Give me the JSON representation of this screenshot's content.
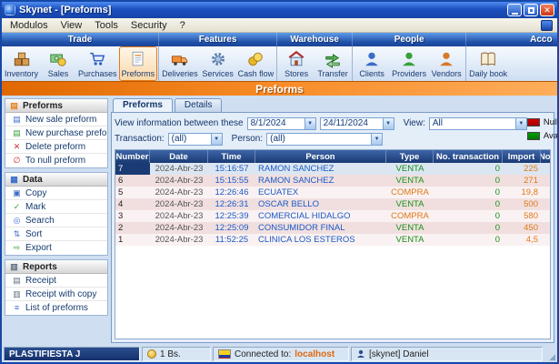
{
  "window": {
    "title": "Skynet - [Preforms]",
    "menu": [
      "Modulos",
      "View",
      "Tools",
      "Security",
      "?"
    ]
  },
  "ribbon": {
    "active_item": "Preforms",
    "groups": [
      {
        "label": "Trade",
        "items": [
          {
            "label": "Inventory",
            "icon": "inventory-icon"
          },
          {
            "label": "Sales",
            "icon": "sales-icon"
          },
          {
            "label": "Purchases",
            "icon": "purchases-icon"
          },
          {
            "label": "Preforms",
            "icon": "preforms-icon"
          }
        ]
      },
      {
        "label": "Features",
        "items": [
          {
            "label": "Deliveries",
            "icon": "deliveries-icon"
          },
          {
            "label": "Services",
            "icon": "services-icon"
          },
          {
            "label": "Cash flow",
            "icon": "cashflow-icon"
          }
        ]
      },
      {
        "label": "Warehouse",
        "items": [
          {
            "label": "Stores",
            "icon": "stores-icon"
          },
          {
            "label": "Transfer",
            "icon": "transfer-icon"
          }
        ]
      },
      {
        "label": "People",
        "items": [
          {
            "label": "Clients",
            "icon": "clients-icon"
          },
          {
            "label": "Providers",
            "icon": "providers-icon"
          },
          {
            "label": "Vendors",
            "icon": "vendors-icon"
          }
        ]
      },
      {
        "label": "Acco",
        "items": [
          {
            "label": "Daily book",
            "icon": "dailybook-icon"
          }
        ]
      }
    ]
  },
  "banner": {
    "title": "Preforms"
  },
  "sidebar": {
    "sections": [
      {
        "title": "Preforms",
        "icon": "preforms-section-icon",
        "items": [
          {
            "label": "New sale preform",
            "icon": "document-blue-icon"
          },
          {
            "label": "New purchase preform",
            "icon": "document-green-icon"
          },
          {
            "label": "Delete preform",
            "icon": "delete-icon"
          },
          {
            "label": "To null preform",
            "icon": "null-icon"
          }
        ]
      },
      {
        "title": "Data",
        "icon": "data-section-icon",
        "items": [
          {
            "label": "Copy",
            "icon": "copy-icon"
          },
          {
            "label": "Mark",
            "icon": "mark-icon"
          },
          {
            "label": "Search",
            "icon": "search-icon"
          },
          {
            "label": "Sort",
            "icon": "sort-icon"
          },
          {
            "label": "Export",
            "icon": "export-icon"
          }
        ]
      },
      {
        "title": "Reports",
        "icon": "reports-section-icon",
        "items": [
          {
            "label": "Receipt",
            "icon": "receipt-icon"
          },
          {
            "label": "Receipt with copy",
            "icon": "receipt-copy-icon"
          },
          {
            "label": "List of preforms",
            "icon": "list-icon"
          }
        ]
      }
    ]
  },
  "main": {
    "tabs": [
      "Preforms",
      "Details"
    ],
    "active_tab": "Preforms",
    "filters": {
      "between_label": "View information between these",
      "date_from": "8/1/2024",
      "date_to": "24/11/2024",
      "view_label": "View:",
      "view_value": "All",
      "transaction_label": "Transaction:",
      "transaction_value": "(all)",
      "person_label": "Person:",
      "person_value": "(all)"
    },
    "legend": [
      {
        "label": "Null transaction",
        "color": "#D80000"
      },
      {
        "label": "Available",
        "color": "#00A000"
      }
    ],
    "table": {
      "columns": [
        "Number",
        "Date",
        "Time",
        "Person",
        "Type",
        "No. transaction",
        "Import",
        "Note"
      ],
      "rows": [
        [
          "7",
          "2024-Abr-23",
          "15:16:57",
          "RAMON SANCHEZ",
          "VENTA",
          "0",
          "225",
          ""
        ],
        [
          "6",
          "2024-Abr-23",
          "15:15:55",
          "RAMON SANCHEZ",
          "VENTA",
          "0",
          "271",
          ""
        ],
        [
          "5",
          "2024-Abr-23",
          "12:26:46",
          "ECUATEX",
          "COMPRA",
          "0",
          "19,8",
          ""
        ],
        [
          "4",
          "2024-Abr-23",
          "12:26:31",
          "OSCAR BELLO",
          "VENTA",
          "0",
          "500",
          ""
        ],
        [
          "3",
          "2024-Abr-23",
          "12:25:39",
          "COMERCIAL HIDALGO",
          "COMPRA",
          "0",
          "580",
          ""
        ],
        [
          "2",
          "2024-Abr-23",
          "12:25:09",
          "CONSUMIDOR FINAL",
          "VENTA",
          "0",
          "450",
          ""
        ],
        [
          "1",
          "2024-Abr-23",
          "11:52:25",
          "CLINICA LOS ESTEROS",
          "VENTA",
          "0",
          "4,5",
          ""
        ]
      ]
    }
  },
  "statusbar": {
    "company": "PLASTIFIESTA J",
    "currency": "1 Bs.",
    "connected_label": "Connected to:",
    "connected_value": "localhost",
    "user": "[skynet] Daniel"
  },
  "colors": {
    "accent_orange": "#F07800",
    "header_navy": "#1A3A74",
    "venta": "#189018",
    "compra": "#E07818"
  }
}
